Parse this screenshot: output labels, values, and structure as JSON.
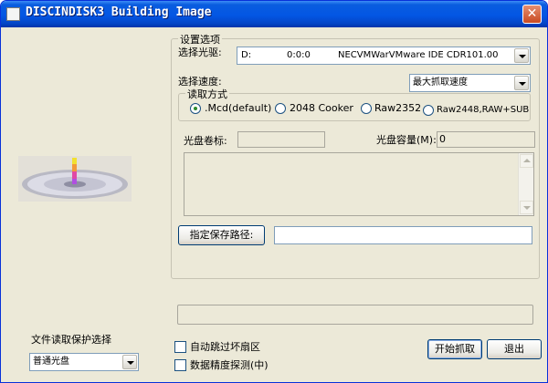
{
  "window": {
    "title": "DISCINDISK3 Building Image",
    "close_glyph": "✕"
  },
  "settings": {
    "group_label": "设置选项",
    "drive_label": "选择光驱:",
    "drive": {
      "letter": "D:",
      "address": "0:0:0",
      "device": "NECVMWarVMware IDE CDR101.00"
    },
    "speed_label": "选择速度:",
    "speed_value": "最大抓取速度",
    "read_mode": {
      "group_label": "读取方式",
      "options": [
        ".Mcd(default)",
        "2048 Cooker",
        "Raw2352",
        "Raw2448,RAW+SUB"
      ],
      "selected_index": 0
    },
    "volume_label": "光盘卷标:",
    "volume_value": "",
    "capacity_label": "光盘容量(M):",
    "capacity_value": "0",
    "log_text": "",
    "save_path_button": "指定保存路径:",
    "save_path_value": ""
  },
  "progress": {
    "value": 0
  },
  "protection": {
    "label": "文件读取保护选择",
    "value": "普通光盘"
  },
  "options": {
    "skip_bad_sectors": {
      "label": "自动跳过坏扇区",
      "checked": false
    },
    "precision_detect": {
      "label": "数据精度探测(中)",
      "checked": false
    }
  },
  "actions": {
    "start": "开始抓取",
    "exit": "退出"
  },
  "icons": {
    "disc": "cd-disc-icon",
    "app": "app-icon",
    "close": "close-icon",
    "dropdown": "chevron-down-icon"
  },
  "colors": {
    "titlebar": "#0356e4",
    "window_bg": "#ece9d8",
    "close_button": "#c94a22"
  }
}
